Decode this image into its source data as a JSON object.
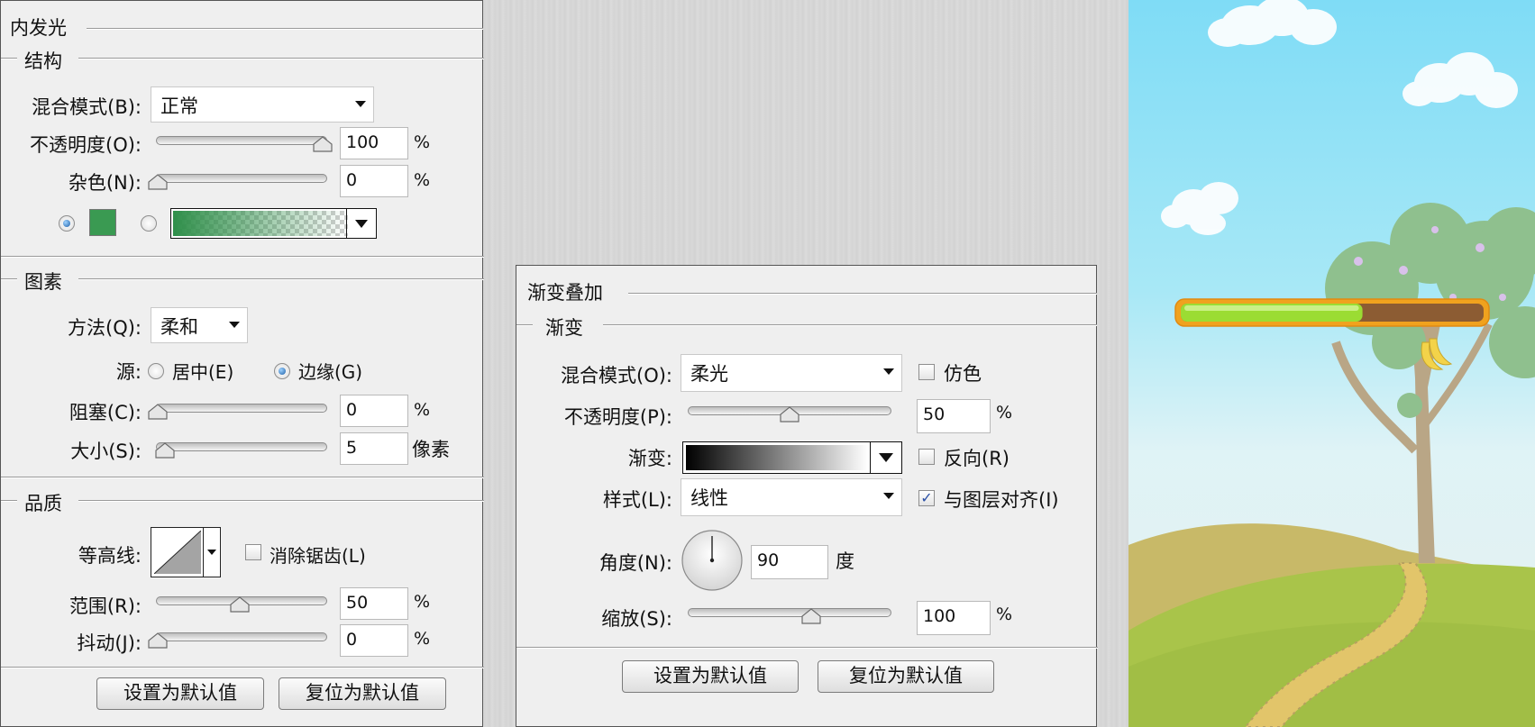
{
  "inner_glow": {
    "title": "内发光",
    "structure": {
      "heading": "结构",
      "blend_label": "混合模式(B):",
      "blend_value": "正常",
      "opacity_label": "不透明度(O):",
      "opacity_value": "100",
      "opacity_unit": "%",
      "noise_label": "杂色(N):",
      "noise_value": "0",
      "noise_unit": "%",
      "color_swatch": "#3a9a52",
      "gradient_colors": [
        "#2f8f4a",
        "#ffffff"
      ]
    },
    "elements": {
      "heading": "图素",
      "method_label": "方法(Q):",
      "method_value": "柔和",
      "source_label": "源:",
      "source_center": "居中(E)",
      "source_edge": "边缘(G)",
      "choke_label": "阻塞(C):",
      "choke_value": "0",
      "choke_unit": "%",
      "size_label": "大小(S):",
      "size_value": "5",
      "size_unit": "像素"
    },
    "quality": {
      "heading": "品质",
      "contour_label": "等高线:",
      "antialias_label": "消除锯齿(L)",
      "range_label": "范围(R):",
      "range_value": "50",
      "range_unit": "%",
      "jitter_label": "抖动(J):",
      "jitter_value": "0",
      "jitter_unit": "%"
    },
    "buttons": {
      "make_default": "设置为默认值",
      "reset_default": "复位为默认值"
    }
  },
  "gradient_overlay": {
    "title": "渐变叠加",
    "heading": "渐变",
    "blend_label": "混合模式(O):",
    "blend_value": "柔光",
    "dither_label": "仿色",
    "opacity_label": "不透明度(P):",
    "opacity_value": "50",
    "opacity_unit": "%",
    "gradient_label": "渐变:",
    "reverse_label": "反向(R)",
    "style_label": "样式(L):",
    "style_value": "线性",
    "align_label": "与图层对齐(I)",
    "align_check": "✓",
    "angle_label": "角度(N):",
    "angle_value": "90",
    "angle_unit": "度",
    "scale_label": "缩放(S):",
    "scale_value": "100",
    "scale_unit": "%",
    "buttons": {
      "make_default": "设置为默认值",
      "reset_default": "复位为默认值"
    }
  },
  "preview": {
    "progress_fraction": 0.6,
    "colors": {
      "sky_top": "#7fdcf6",
      "sky_bottom": "#dff3f6",
      "bar_fill": "#9bdc33",
      "bar_track": "#8c5c33",
      "bar_border": "#f0a21e"
    }
  }
}
